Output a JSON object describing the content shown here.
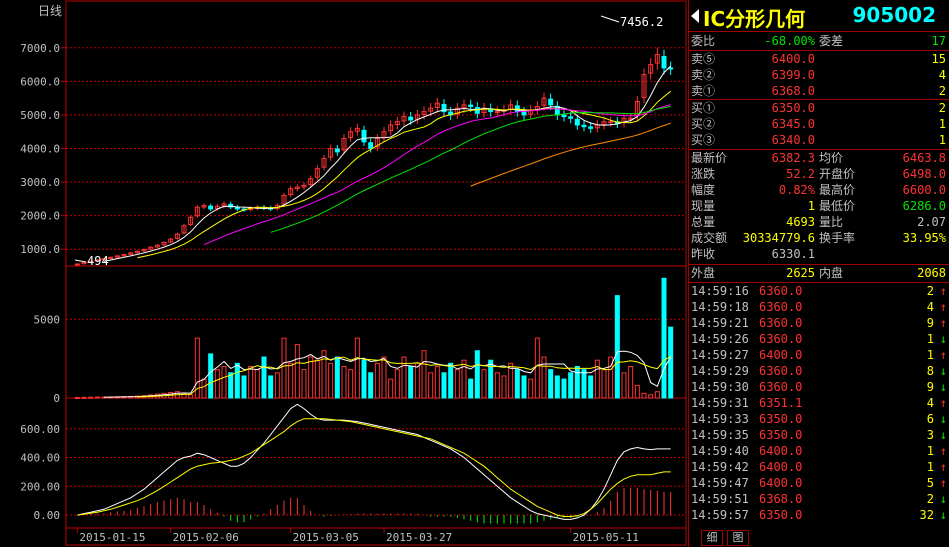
{
  "header": {
    "period_label": "日线",
    "price_max_label": "7456.2",
    "price_min_label": "494"
  },
  "title": {
    "name": "IC分形几何",
    "code": "905002"
  },
  "quote": {
    "weibi": {
      "label": "委比",
      "value": "-68.00%",
      "label2": "委差",
      "value2": "17"
    },
    "sells": [
      {
        "label": "卖⑤",
        "price": "6400.0",
        "vol": "15"
      },
      {
        "label": "卖②",
        "price": "6399.0",
        "vol": "4"
      },
      {
        "label": "卖①",
        "price": "6368.0",
        "vol": "2"
      }
    ],
    "buys": [
      {
        "label": "买①",
        "price": "6350.0",
        "vol": "2"
      },
      {
        "label": "买②",
        "price": "6345.0",
        "vol": "1"
      },
      {
        "label": "买③",
        "price": "6340.0",
        "vol": "1"
      }
    ],
    "stats": [
      {
        "l1": "最新价",
        "v1": "6382.3",
        "l2": "均价",
        "v2": "6463.8",
        "c1": "r",
        "c2": "r"
      },
      {
        "l1": "涨跌",
        "v1": "52.2",
        "l2": "开盘价",
        "v2": "6498.0",
        "c1": "r",
        "c2": "r"
      },
      {
        "l1": "幅度",
        "v1": "0.82%",
        "l2": "最高价",
        "v2": "6600.0",
        "c1": "r",
        "c2": "r"
      },
      {
        "l1": "现量",
        "v1": "1",
        "l2": "最低价",
        "v2": "6286.0",
        "c1": "y",
        "c2": "g"
      },
      {
        "l1": "总量",
        "v1": "4693",
        "l2": "量比",
        "v2": "2.07",
        "c1": "y",
        "c2": "w"
      },
      {
        "l1": "成交额",
        "v1": "30334779.6",
        "l2": "换手率",
        "v2": "33.95%",
        "c1": "y",
        "c2": "y"
      },
      {
        "l1": "昨收",
        "v1": "6330.1",
        "l2": "",
        "v2": "",
        "c1": "w",
        "c2": "w"
      }
    ],
    "outer": {
      "label": "外盘",
      "value": "2625",
      "label2": "内盘",
      "value2": "2068"
    }
  },
  "ticks": [
    {
      "time": "14:59:16",
      "price": "6360.0",
      "vol": "2",
      "dir": "up"
    },
    {
      "time": "14:59:18",
      "price": "6360.0",
      "vol": "4",
      "dir": "up"
    },
    {
      "time": "14:59:21",
      "price": "6360.0",
      "vol": "9",
      "dir": "up"
    },
    {
      "time": "14:59:26",
      "price": "6360.0",
      "vol": "1",
      "dir": "down"
    },
    {
      "time": "14:59:27",
      "price": "6400.0",
      "vol": "1",
      "dir": "up"
    },
    {
      "time": "14:59:29",
      "price": "6360.0",
      "vol": "8",
      "dir": "down"
    },
    {
      "time": "14:59:30",
      "price": "6360.0",
      "vol": "9",
      "dir": "down"
    },
    {
      "time": "14:59:31",
      "price": "6351.1",
      "vol": "4",
      "dir": "up"
    },
    {
      "time": "14:59:33",
      "price": "6350.0",
      "vol": "6",
      "dir": "down"
    },
    {
      "time": "14:59:35",
      "price": "6350.0",
      "vol": "3",
      "dir": "down"
    },
    {
      "time": "14:59:40",
      "price": "6400.0",
      "vol": "1",
      "dir": "up"
    },
    {
      "time": "14:59:42",
      "price": "6400.0",
      "vol": "1",
      "dir": "up"
    },
    {
      "time": "14:59:47",
      "price": "6400.0",
      "vol": "5",
      "dir": "up"
    },
    {
      "time": "14:59:51",
      "price": "6368.0",
      "vol": "2",
      "dir": "down"
    },
    {
      "time": "14:59:57",
      "price": "6350.0",
      "vol": "32",
      "dir": "down"
    }
  ],
  "tabs": [
    "细",
    "图"
  ],
  "colors": {
    "up": "#ff3232",
    "down": "#00ffff",
    "grid": "#c00000",
    "ma5": "#ffffff",
    "ma10": "#ffff00",
    "ma20": "#ff00ff",
    "ma30": "#00e600",
    "ma60": "#ff8c00",
    "macd_neg": "#00e600"
  },
  "chart_data": {
    "type": "candlestick",
    "title": "",
    "x_labels": [
      "2015-01-15",
      "2015-02-06",
      "2015-03-05",
      "2015-03-27",
      "2015-05-11"
    ],
    "y_ticks_price": [
      "7000.0",
      "6000.0",
      "5000.0",
      "4000.0",
      "3000.0",
      "2000.0",
      "1000.0"
    ],
    "y_ticks_volume": [
      "5000",
      "0"
    ],
    "y_ticks_macd": [
      "600.00",
      "400.00",
      "200.00",
      "0.00"
    ],
    "price_range": [
      500,
      7500
    ],
    "volume_range": [
      0,
      8000
    ],
    "macd_range": [
      -90,
      800
    ],
    "n_days": 90,
    "price_highlights": [
      {
        "label": "7456.2",
        "type": "max"
      },
      {
        "label": "494",
        "type": "min"
      }
    ],
    "close": [
      560,
      600,
      640,
      680,
      720,
      760,
      800,
      840,
      890,
      940,
      990,
      1060,
      1120,
      1200,
      1300,
      1450,
      1700,
      1950,
      2250,
      2300,
      2200,
      2280,
      2350,
      2260,
      2200,
      2180,
      2220,
      2250,
      2230,
      2200,
      2300,
      2600,
      2800,
      2850,
      2900,
      3100,
      3400,
      3700,
      4000,
      3900,
      4300,
      4500,
      4600,
      4200,
      4000,
      4300,
      4500,
      4700,
      4800,
      4950,
      4850,
      5000,
      5100,
      5200,
      5350,
      5100,
      5000,
      5200,
      5300,
      5250,
      5050,
      5200,
      5100,
      5100,
      5150,
      5300,
      5100,
      5000,
      5150,
      5250,
      5500,
      5300,
      5000,
      4950,
      4900,
      4700,
      4650,
      4600,
      4700,
      4800,
      4800,
      4750,
      4900,
      4900,
      5400,
      6200,
      6500,
      6800,
      6400,
      6382
    ],
    "volume": [
      30,
      40,
      50,
      60,
      60,
      70,
      80,
      90,
      100,
      120,
      150,
      200,
      250,
      300,
      350,
      400,
      300,
      200,
      3800,
      1200,
      2800,
      1800,
      2000,
      1600,
      2200,
      1400,
      2000,
      1800,
      2600,
      1400,
      1600,
      3800,
      2200,
      3400,
      1800,
      2600,
      2400,
      3000,
      2200,
      2600,
      2000,
      1800,
      3800,
      2400,
      1600,
      2200,
      2600,
      1200,
      1800,
      2600,
      2000,
      2200,
      3000,
      1600,
      2000,
      1600,
      2200,
      1800,
      2400,
      1200,
      3000,
      1800,
      2400,
      1600,
      1400,
      2200,
      1800,
      1400,
      1200,
      3800,
      2600,
      1800,
      1400,
      1200,
      1600,
      2000,
      1800,
      1400,
      2400,
      1800,
      2600,
      6500,
      1600,
      2000,
      800,
      300,
      200,
      400,
      7600,
      4500
    ],
    "macd_signal_start": 0,
    "macd_dif": [
      0,
      10,
      20,
      30,
      40,
      60,
      80,
      100,
      120,
      150,
      180,
      220,
      260,
      300,
      340,
      380,
      400,
      410,
      430,
      420,
      400,
      380,
      360,
      340,
      340,
      360,
      400,
      450,
      500,
      560,
      620,
      680,
      740,
      770,
      740,
      700,
      670,
      660,
      660,
      660,
      660,
      655,
      650,
      640,
      630,
      620,
      610,
      600,
      590,
      580,
      570,
      560,
      540,
      520,
      500,
      480,
      460,
      430,
      400,
      360,
      320,
      280,
      240,
      200,
      160,
      120,
      90,
      60,
      30,
      10,
      0,
      -10,
      -20,
      -30,
      -30,
      -20,
      0,
      40,
      100,
      180,
      280,
      380,
      440,
      460,
      470,
      460,
      455,
      460,
      460,
      460
    ],
    "macd_dea": [
      0,
      5,
      12,
      20,
      30,
      40,
      55,
      70,
      85,
      100,
      120,
      145,
      170,
      200,
      230,
      260,
      290,
      320,
      340,
      350,
      360,
      365,
      370,
      380,
      390,
      410,
      430,
      460,
      490,
      520,
      550,
      580,
      620,
      650,
      670,
      670,
      670,
      670,
      665,
      660,
      655,
      650,
      640,
      630,
      620,
      610,
      600,
      590,
      580,
      570,
      560,
      550,
      540,
      530,
      510,
      490,
      470,
      450,
      430,
      400,
      370,
      340,
      300,
      260,
      220,
      180,
      150,
      120,
      90,
      60,
      40,
      20,
      0,
      -10,
      -10,
      -5,
      10,
      40,
      80,
      130,
      180,
      220,
      250,
      270,
      280,
      280,
      280,
      290,
      300,
      300
    ]
  }
}
